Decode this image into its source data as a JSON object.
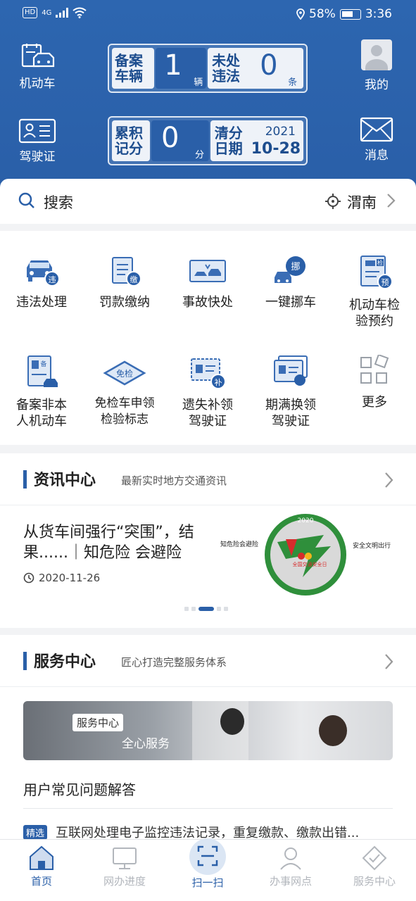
{
  "status_bar": {
    "network": "HD",
    "signal": "4G",
    "battery": "58%",
    "time": "3:36"
  },
  "header": {
    "vehicle_label": "机动车",
    "license_label": "驾驶证",
    "me_label": "我的",
    "message_label": "消息",
    "vehicle_panel": {
      "registered_label_1": "备案",
      "registered_label_2": "车辆",
      "registered_value": "1",
      "registered_unit": "辆",
      "violation_label_1": "未处",
      "violation_label_2": "违法",
      "violation_value": "0",
      "violation_unit": "条"
    },
    "license_panel": {
      "points_label_1": "累积",
      "points_label_2": "记分",
      "points_value": "0",
      "points_unit": "分",
      "clear_label_1": "清分",
      "clear_label_2": "日期",
      "clear_year": "2021",
      "clear_date": "10-28"
    }
  },
  "search": {
    "placeholder": "搜索",
    "location": "渭南"
  },
  "services": [
    {
      "label": "违法处理",
      "icon": "violation-car-icon"
    },
    {
      "label": "罚款缴纳",
      "icon": "fine-payment-icon"
    },
    {
      "label": "事故快处",
      "icon": "accident-icon"
    },
    {
      "label": "一键挪车",
      "icon": "move-car-icon"
    },
    {
      "label": "机动车检验预约",
      "icon": "inspection-icon"
    },
    {
      "label": "备案非本人机动车",
      "icon": "register-vehicle-icon"
    },
    {
      "label": "免检车申领检验标志",
      "icon": "exempt-label-icon"
    },
    {
      "label": "遗失补领驾驶证",
      "icon": "lost-license-icon"
    },
    {
      "label": "期满换领驾驶证",
      "icon": "renew-license-icon"
    },
    {
      "label": "更多",
      "icon": "more-grid-icon"
    }
  ],
  "services_lines": [
    [
      "违法处理"
    ],
    [
      "罚款缴纳"
    ],
    [
      "事故快处"
    ],
    [
      "一键挪车"
    ],
    [
      "机动车检",
      "验预约"
    ],
    [
      "备案非本",
      "人机动车"
    ],
    [
      "免检车申领",
      "检验标志"
    ],
    [
      "遗失补领",
      "驾驶证"
    ],
    [
      "期满换领",
      "驾驶证"
    ],
    [
      "更多"
    ]
  ],
  "news": {
    "title": "资讯中心",
    "subtitle": "最新实时地方交通资讯",
    "headline": "从货车间强行“突围”，结果......｜知危险 会避险",
    "date": "2020-11-26",
    "image_left_text": "知危险会避险",
    "image_right_text": "安全文明出行",
    "image_year": "2020",
    "image_badge": "全国交通安全日"
  },
  "service_center": {
    "title": "服务中心",
    "subtitle": "匠心打造完整服务体系",
    "banner_tag": "服务中心",
    "banner_text": "全心服务",
    "faq_title": "用户常见问题解答",
    "faq_badge": "精选",
    "faq_item": "互联网处理电子监控违法记录，重复缴款、缴款出错..."
  },
  "tabs": [
    {
      "label": "首页",
      "icon": "home-icon",
      "active": true
    },
    {
      "label": "网办进度",
      "icon": "monitor-icon",
      "active": false
    },
    {
      "label": "扫一扫",
      "icon": "scan-icon",
      "active": false
    },
    {
      "label": "办事网点",
      "icon": "service-point-icon",
      "active": false
    },
    {
      "label": "服务中心",
      "icon": "service-center-icon",
      "active": false
    }
  ],
  "colors": {
    "primary": "#2a5fa8",
    "header_bg": "#2d66b0",
    "page_bg": "#f2f3f5"
  }
}
